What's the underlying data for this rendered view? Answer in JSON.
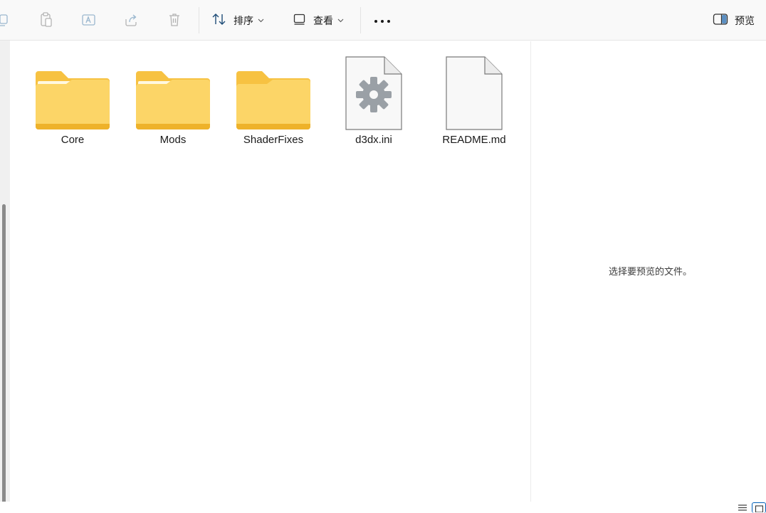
{
  "toolbar": {
    "sort_label": "排序",
    "view_label": "查看",
    "preview_label": "预览"
  },
  "files": [
    {
      "name": "Core",
      "type": "folder"
    },
    {
      "name": "Mods",
      "type": "folder"
    },
    {
      "name": "ShaderFixes",
      "type": "folder"
    },
    {
      "name": "d3dx.ini",
      "type": "settings-file"
    },
    {
      "name": "README.md",
      "type": "document"
    }
  ],
  "preview": {
    "empty_message": "选择要预览的文件。"
  },
  "colors": {
    "folder_back": "#f7c242",
    "folder_front": "#fdd870",
    "accent": "#005fb8"
  }
}
